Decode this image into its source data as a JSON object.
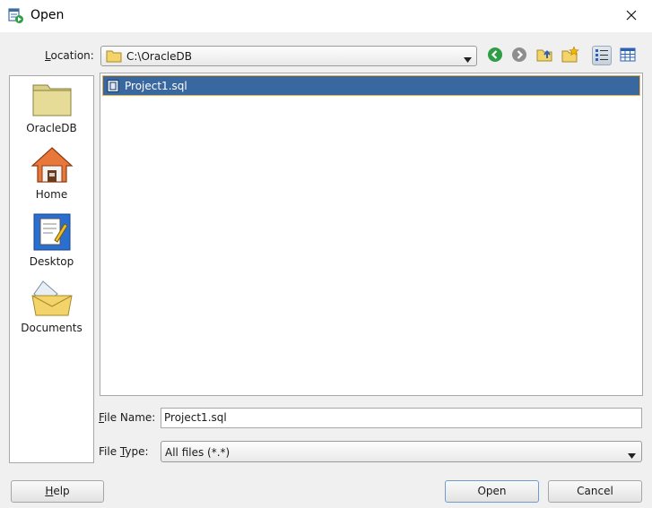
{
  "window": {
    "title": "Open",
    "close_icon": "close-icon"
  },
  "location": {
    "label_prefix": "",
    "label_mnemonic": "L",
    "label_rest": "ocation:",
    "value": "C:\\OracleDB"
  },
  "toolbar": {
    "icons": [
      "back-icon",
      "forward-icon",
      "up-folder-icon",
      "new-folder-icon",
      "list-view-icon",
      "details-view-icon"
    ],
    "colors": {
      "back": "#2f9e44",
      "forward": "#8e8e8e",
      "folder": "#e8c24a"
    }
  },
  "places": [
    {
      "label": "OracleDB",
      "icon": "folder-icon"
    },
    {
      "label": "Home",
      "icon": "home-icon"
    },
    {
      "label": "Desktop",
      "icon": "desktop-icon"
    },
    {
      "label": "Documents",
      "icon": "documents-icon"
    }
  ],
  "files": [
    {
      "name": "Project1.sql",
      "icon": "sql-file-icon",
      "selected": true
    }
  ],
  "file_name": {
    "label_mnemonic": "F",
    "label_rest": "ile Name:",
    "value": "Project1.sql"
  },
  "file_type": {
    "label_prefix": "File ",
    "label_mnemonic": "T",
    "label_rest": "ype:",
    "value": "All files (*.*)"
  },
  "buttons": {
    "help_mnemonic": "H",
    "help_rest": "elp",
    "open": "Open",
    "cancel": "Cancel"
  },
  "colors": {
    "selection": "#39679f",
    "selection_border": "#e8b44a",
    "default_button_border": "#6f9ccf"
  }
}
